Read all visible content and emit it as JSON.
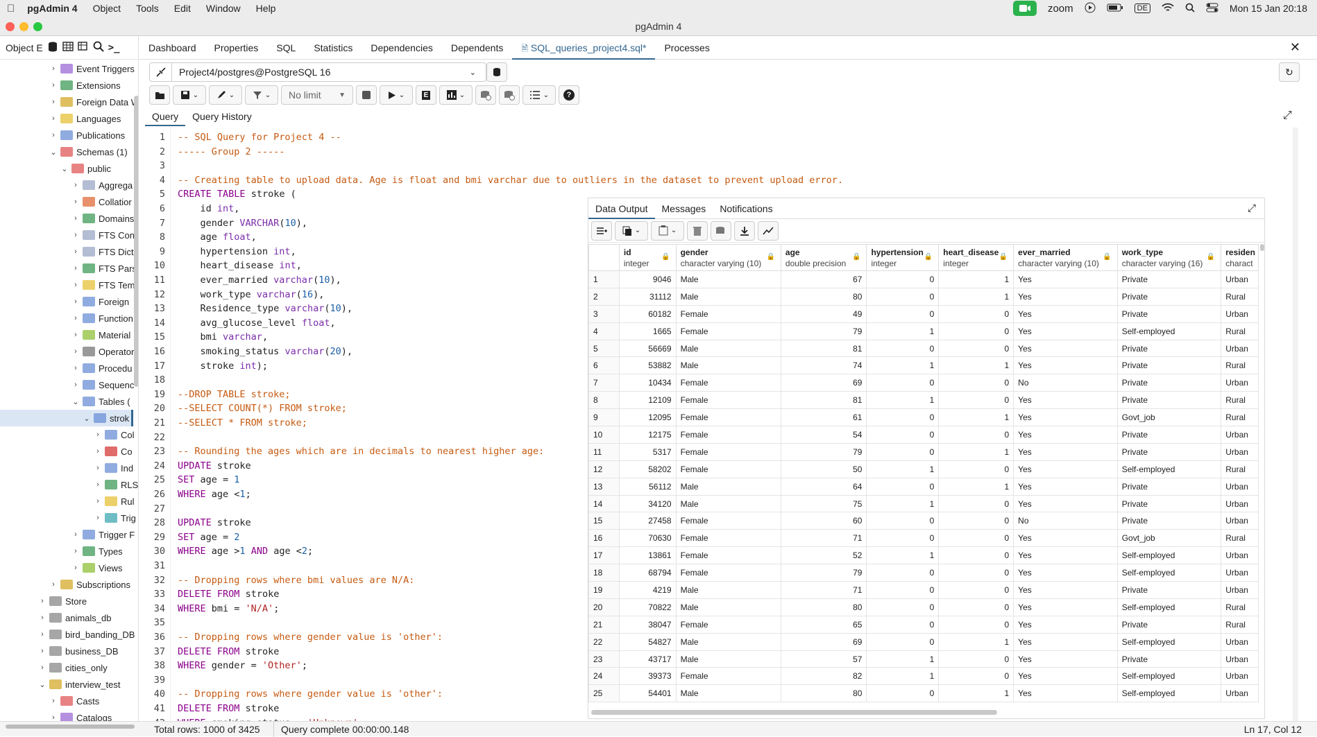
{
  "menubar": {
    "app": "pgAdmin 4",
    "items": [
      "Object",
      "Tools",
      "Edit",
      "Window",
      "Help"
    ],
    "zoom": "zoom",
    "kbd": "DE",
    "clock": "Mon 15 Jan  20:18"
  },
  "window": {
    "title": "pgAdmin 4"
  },
  "sidebar": {
    "header": "Object E",
    "tree": [
      {
        "label": "Event Triggers",
        "indent": 0,
        "chev": "›",
        "color": "#9c6bd6"
      },
      {
        "label": "Extensions",
        "indent": 0,
        "chev": "›",
        "color": "#3f9b58"
      },
      {
        "label": "Foreign Data W",
        "indent": 0,
        "chev": "›",
        "color": "#d4a92b"
      },
      {
        "label": "Languages",
        "indent": 0,
        "chev": "›",
        "color": "#e6c23a"
      },
      {
        "label": "Publications",
        "indent": 0,
        "chev": "›",
        "color": "#6b8fd6"
      },
      {
        "label": "Schemas (1)",
        "indent": 0,
        "chev": "⌄",
        "color": "#e05a5a"
      },
      {
        "label": "public",
        "indent": 1,
        "chev": "⌄",
        "color": "#e05a5a"
      },
      {
        "label": "Aggrega",
        "indent": 2,
        "chev": "›",
        "color": "#9aa7c4"
      },
      {
        "label": "Collatior",
        "indent": 2,
        "chev": "›",
        "color": "#e06b3a"
      },
      {
        "label": "Domains",
        "indent": 2,
        "chev": "›",
        "color": "#3f9b58"
      },
      {
        "label": "FTS Con",
        "indent": 2,
        "chev": "›",
        "color": "#9aa7c4"
      },
      {
        "label": "FTS Dict",
        "indent": 2,
        "chev": "›",
        "color": "#9aa7c4"
      },
      {
        "label": "FTS Pars",
        "indent": 2,
        "chev": "›",
        "color": "#3f9b58"
      },
      {
        "label": "FTS Tem",
        "indent": 2,
        "chev": "›",
        "color": "#e6c23a"
      },
      {
        "label": "Foreign",
        "indent": 2,
        "chev": "›",
        "color": "#6b8fd6"
      },
      {
        "label": "Function",
        "indent": 2,
        "chev": "›",
        "color": "#6b8fd6"
      },
      {
        "label": "Material",
        "indent": 2,
        "chev": "›",
        "color": "#8fbf3a"
      },
      {
        "label": "Operator",
        "indent": 2,
        "chev": "›",
        "color": "#777777"
      },
      {
        "label": "Procedu",
        "indent": 2,
        "chev": "›",
        "color": "#6b8fd6"
      },
      {
        "label": "Sequenc",
        "indent": 2,
        "chev": "›",
        "color": "#6b8fd6"
      },
      {
        "label": "Tables (",
        "indent": 2,
        "chev": "⌄",
        "color": "#6b8fd6"
      },
      {
        "label": "strok",
        "indent": 3,
        "chev": "⌄",
        "color": "#6b8fd6",
        "selected": true
      },
      {
        "label": "Col",
        "indent": 4,
        "chev": "›",
        "color": "#6b8fd6"
      },
      {
        "label": "Co",
        "indent": 4,
        "chev": "›",
        "color": "#d63a3a"
      },
      {
        "label": "Ind",
        "indent": 4,
        "chev": "›",
        "color": "#6b8fd6"
      },
      {
        "label": "RLS",
        "indent": 4,
        "chev": "›",
        "color": "#3f9b58"
      },
      {
        "label": "Rul",
        "indent": 4,
        "chev": "›",
        "color": "#e6c23a"
      },
      {
        "label": "Trig",
        "indent": 4,
        "chev": "›",
        "color": "#3fa7b0"
      },
      {
        "label": "Trigger F",
        "indent": 2,
        "chev": "›",
        "color": "#6b8fd6"
      },
      {
        "label": "Types",
        "indent": 2,
        "chev": "›",
        "color": "#3f9b58"
      },
      {
        "label": "Views",
        "indent": 2,
        "chev": "›",
        "color": "#8fbf3a"
      },
      {
        "label": "Subscriptions",
        "indent": 0,
        "chev": "›",
        "color": "#d4a92b"
      },
      {
        "label": "Store",
        "indent": -1,
        "chev": "›",
        "color": "#888888"
      },
      {
        "label": "animals_db",
        "indent": -1,
        "chev": "›",
        "color": "#888888"
      },
      {
        "label": "bird_banding_DB",
        "indent": -1,
        "chev": "›",
        "color": "#888888"
      },
      {
        "label": "business_DB",
        "indent": -1,
        "chev": "›",
        "color": "#888888"
      },
      {
        "label": "cities_only",
        "indent": -1,
        "chev": "›",
        "color": "#888888"
      },
      {
        "label": "interview_test",
        "indent": -1,
        "chev": "⌄",
        "color": "#d4a92b"
      },
      {
        "label": "Casts",
        "indent": 0,
        "chev": "›",
        "color": "#e05a5a"
      },
      {
        "label": "Catalogs",
        "indent": 0,
        "chev": "›",
        "color": "#9c6bd6"
      }
    ]
  },
  "tabs": [
    "Dashboard",
    "Properties",
    "SQL",
    "Statistics",
    "Dependencies",
    "Dependents",
    "SQL_queries_project4.sql*",
    "Processes"
  ],
  "connection": "Project4/postgres@PostgreSQL 16",
  "limit": "No limit",
  "editor_tabs": [
    "Query",
    "Query History"
  ],
  "code": [
    "-- SQL Query for Project 4 --",
    "----- Group 2 -----",
    "",
    "-- Creating table to upload data. Age is float and bmi varchar due to outliers in the dataset to prevent upload error.",
    "CREATE TABLE stroke (",
    "    id int,",
    "    gender VARCHAR(10),",
    "    age float,",
    "    hypertension int,",
    "    heart_disease int,",
    "    ever_married varchar(10),",
    "    work_type varchar(16),",
    "    Residence_type varchar(10),",
    "    avg_glucose_level float,",
    "    bmi varchar,",
    "    smoking_status varchar(20),",
    "    stroke int);",
    "",
    "--DROP TABLE stroke;",
    "--SELECT COUNT(*) FROM stroke;",
    "--SELECT * FROM stroke;",
    "",
    "-- Rounding the ages which are in decimals to nearest higher age:",
    "UPDATE stroke",
    "SET age = 1",
    "WHERE age <1;",
    "",
    "UPDATE stroke",
    "SET age = 2",
    "WHERE age >1 AND age <2;",
    "",
    "-- Dropping rows where bmi values are N/A:",
    "DELETE FROM stroke",
    "WHERE bmi = 'N/A';",
    "",
    "-- Dropping rows where gender value is 'other':",
    "DELETE FROM stroke",
    "WHERE gender = 'Other';",
    "",
    "-- Dropping rows where gender value is 'other':",
    "DELETE FROM stroke",
    "WHERE smoking_status = 'Unknown';"
  ],
  "results": {
    "tabs": [
      "Data Output",
      "Messages",
      "Notifications"
    ],
    "columns": [
      {
        "name": "id",
        "type": "integer"
      },
      {
        "name": "gender",
        "type": "character varying (10)"
      },
      {
        "name": "age",
        "type": "double precision"
      },
      {
        "name": "hypertension",
        "type": "integer"
      },
      {
        "name": "heart_disease",
        "type": "integer"
      },
      {
        "name": "ever_married",
        "type": "character varying (10)"
      },
      {
        "name": "work_type",
        "type": "character varying (16)"
      },
      {
        "name": "residen",
        "type": "charact"
      }
    ],
    "rows": [
      [
        1,
        9046,
        "Male",
        67,
        0,
        1,
        "Yes",
        "Private",
        "Urban"
      ],
      [
        2,
        31112,
        "Male",
        80,
        0,
        1,
        "Yes",
        "Private",
        "Rural"
      ],
      [
        3,
        60182,
        "Female",
        49,
        0,
        0,
        "Yes",
        "Private",
        "Urban"
      ],
      [
        4,
        1665,
        "Female",
        79,
        1,
        0,
        "Yes",
        "Self-employed",
        "Rural"
      ],
      [
        5,
        56669,
        "Male",
        81,
        0,
        0,
        "Yes",
        "Private",
        "Urban"
      ],
      [
        6,
        53882,
        "Male",
        74,
        1,
        1,
        "Yes",
        "Private",
        "Rural"
      ],
      [
        7,
        10434,
        "Female",
        69,
        0,
        0,
        "No",
        "Private",
        "Urban"
      ],
      [
        8,
        12109,
        "Female",
        81,
        1,
        0,
        "Yes",
        "Private",
        "Rural"
      ],
      [
        9,
        12095,
        "Female",
        61,
        0,
        1,
        "Yes",
        "Govt_job",
        "Rural"
      ],
      [
        10,
        12175,
        "Female",
        54,
        0,
        0,
        "Yes",
        "Private",
        "Urban"
      ],
      [
        11,
        5317,
        "Female",
        79,
        0,
        1,
        "Yes",
        "Private",
        "Urban"
      ],
      [
        12,
        58202,
        "Female",
        50,
        1,
        0,
        "Yes",
        "Self-employed",
        "Rural"
      ],
      [
        13,
        56112,
        "Male",
        64,
        0,
        1,
        "Yes",
        "Private",
        "Urban"
      ],
      [
        14,
        34120,
        "Male",
        75,
        1,
        0,
        "Yes",
        "Private",
        "Urban"
      ],
      [
        15,
        27458,
        "Female",
        60,
        0,
        0,
        "No",
        "Private",
        "Urban"
      ],
      [
        16,
        70630,
        "Female",
        71,
        0,
        0,
        "Yes",
        "Govt_job",
        "Rural"
      ],
      [
        17,
        13861,
        "Female",
        52,
        1,
        0,
        "Yes",
        "Self-employed",
        "Urban"
      ],
      [
        18,
        68794,
        "Female",
        79,
        0,
        0,
        "Yes",
        "Self-employed",
        "Urban"
      ],
      [
        19,
        4219,
        "Male",
        71,
        0,
        0,
        "Yes",
        "Private",
        "Urban"
      ],
      [
        20,
        70822,
        "Male",
        80,
        0,
        0,
        "Yes",
        "Self-employed",
        "Rural"
      ],
      [
        21,
        38047,
        "Female",
        65,
        0,
        0,
        "Yes",
        "Private",
        "Rural"
      ],
      [
        22,
        54827,
        "Male",
        69,
        0,
        1,
        "Yes",
        "Self-employed",
        "Urban"
      ],
      [
        23,
        43717,
        "Male",
        57,
        1,
        0,
        "Yes",
        "Private",
        "Urban"
      ],
      [
        24,
        39373,
        "Female",
        82,
        1,
        0,
        "Yes",
        "Self-employed",
        "Urban"
      ],
      [
        25,
        54401,
        "Male",
        80,
        0,
        1,
        "Yes",
        "Self-employed",
        "Urban"
      ]
    ]
  },
  "status": {
    "rows": "Total rows: 1000 of 3425",
    "query": "Query complete 00:00:00.148",
    "cursor": "Ln 17, Col 12"
  }
}
